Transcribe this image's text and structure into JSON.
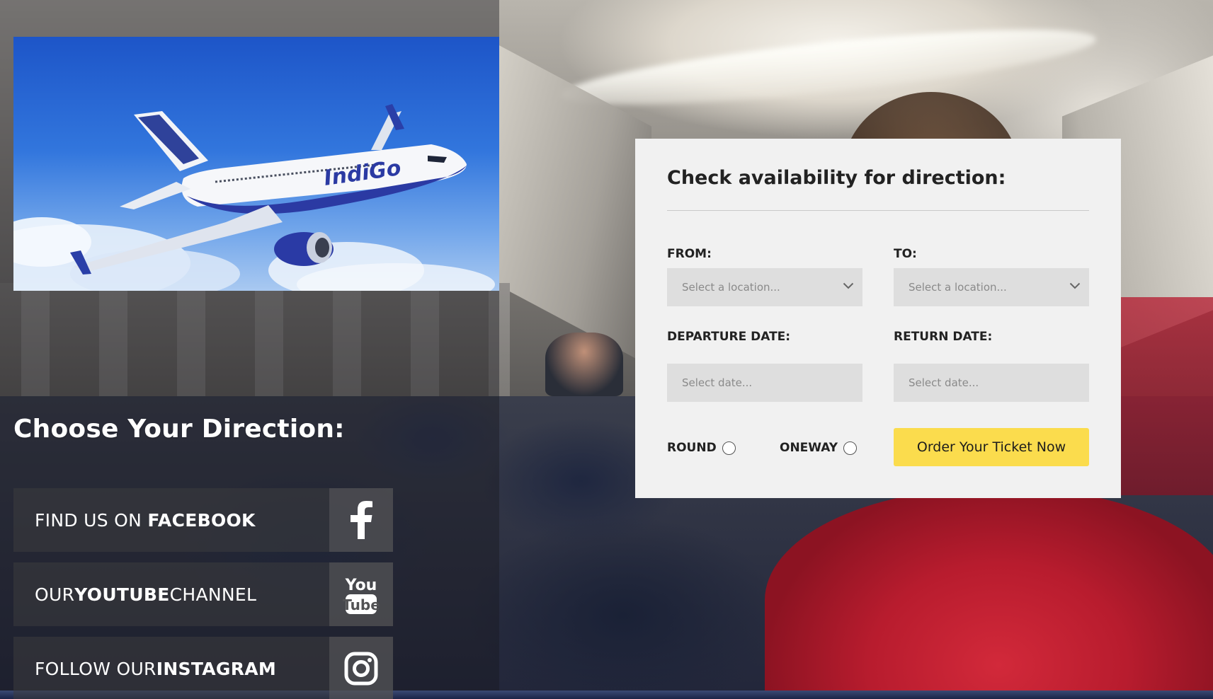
{
  "colors": {
    "accent_button": "#fbdc4d",
    "card_background": "#f1f1f1",
    "field_background": "#dedede",
    "sky_blue": "#1d55c8"
  },
  "hero": {
    "airline_livery_text": "IndiGo",
    "icon": "airplane-photo"
  },
  "left": {
    "direction_title": "Choose Your Direction:",
    "social": [
      {
        "prefix": "FIND US ON ",
        "bold": "FACEBOOK",
        "suffix": "",
        "icon": "facebook-icon"
      },
      {
        "prefix": "OUR ",
        "bold": "YOUTUBE",
        "suffix": " CHANNEL",
        "icon": "youtube-icon",
        "icon_text_top": "You",
        "icon_text_bottom": "Tube"
      },
      {
        "prefix": "FOLLOW OUR ",
        "bold": "INSTAGRAM",
        "suffix": "",
        "icon": "instagram-icon"
      }
    ]
  },
  "form": {
    "heading": "Check availability for direction:",
    "from_label": "FROM:",
    "to_label": "TO:",
    "from_placeholder": "Select a location...",
    "to_placeholder": "Select a location...",
    "departure_label": "DEPARTURE DATE:",
    "return_label": "RETURN DATE:",
    "departure_placeholder": "Select date...",
    "return_placeholder": "Select date...",
    "round_label": "ROUND",
    "oneway_label": "ONEWAY",
    "order_button": "Order Your Ticket Now"
  }
}
